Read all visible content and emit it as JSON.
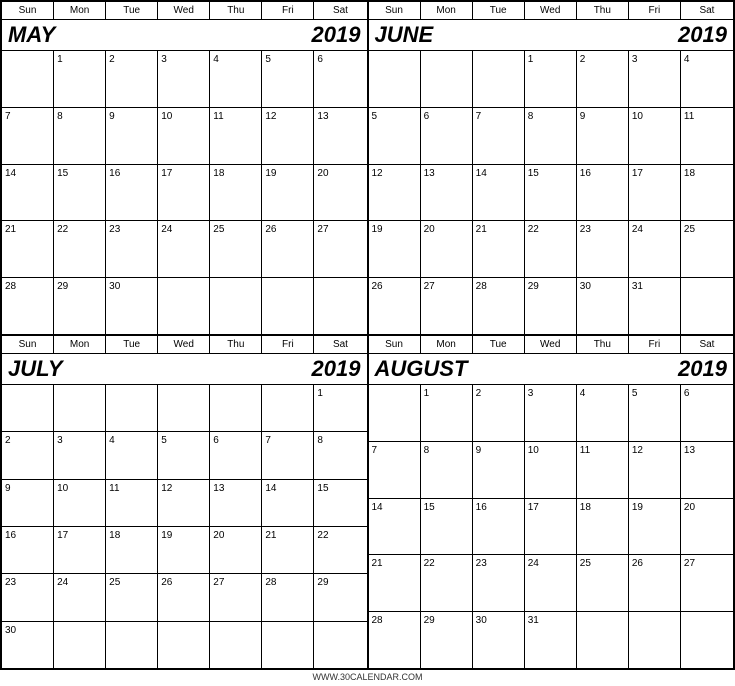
{
  "footer": "WWW.30CALENDAR.COM",
  "calendars": [
    {
      "id": "may",
      "month": "MAY",
      "year": "2019",
      "days": [
        "Sun",
        "Mon",
        "Tue",
        "Wed",
        "Thu",
        "Fri",
        "Sat"
      ],
      "weeks": [
        [
          "",
          "1",
          "2",
          "3",
          "4",
          "5",
          "6"
        ],
        [
          "7",
          "8",
          "9",
          "10",
          "11",
          "12",
          "13"
        ],
        [
          "14",
          "15",
          "16",
          "17",
          "18",
          "19",
          "20"
        ],
        [
          "21",
          "22",
          "23",
          "24",
          "25",
          "26",
          "27"
        ],
        [
          "28",
          "29",
          "30",
          "",
          "",
          "",
          ""
        ]
      ]
    },
    {
      "id": "june",
      "month": "JUNE",
      "year": "2019",
      "days": [
        "Sun",
        "Mon",
        "Tue",
        "Wed",
        "Thu",
        "Fri",
        "Sat"
      ],
      "weeks": [
        [
          "",
          "",
          "",
          "",
          "",
          "1",
          "2",
          "3",
          "4"
        ],
        [
          "5",
          "6",
          "7",
          "8",
          "9",
          "10",
          "11"
        ],
        [
          "12",
          "13",
          "14",
          "15",
          "16",
          "17",
          "18"
        ],
        [
          "19",
          "20",
          "21",
          "22",
          "23",
          "24",
          "25"
        ],
        [
          "26",
          "27",
          "28",
          "29",
          "30",
          "31",
          ""
        ]
      ]
    },
    {
      "id": "july",
      "month": "JULY",
      "year": "2019",
      "days": [
        "Sun",
        "Mon",
        "Tue",
        "Wed",
        "Thu",
        "Fri",
        "Sat"
      ],
      "weeks": [
        [
          "",
          "",
          "",
          "",
          "",
          "",
          "1"
        ],
        [
          "2",
          "3",
          "4",
          "5",
          "6",
          "7",
          "8"
        ],
        [
          "9",
          "10",
          "11",
          "12",
          "13",
          "14",
          "15"
        ],
        [
          "16",
          "17",
          "18",
          "19",
          "20",
          "21",
          "22"
        ],
        [
          "23",
          "24",
          "25",
          "26",
          "27",
          "28",
          "29"
        ],
        [
          "30",
          "",
          "",
          "",
          "",
          "",
          ""
        ]
      ]
    },
    {
      "id": "august",
      "month": "AUGUST",
      "year": "2019",
      "days": [
        "Sun",
        "Mon",
        "Tue",
        "Wed",
        "Thu",
        "Fri",
        "Sat"
      ],
      "weeks": [
        [
          "",
          "1",
          "2",
          "3",
          "4",
          "5",
          "6"
        ],
        [
          "7",
          "8",
          "9",
          "10",
          "11",
          "12",
          "13"
        ],
        [
          "14",
          "15",
          "16",
          "17",
          "18",
          "19",
          "20"
        ],
        [
          "21",
          "22",
          "23",
          "24",
          "25",
          "26",
          "27"
        ],
        [
          "28",
          "29",
          "30",
          "31",
          "",
          "",
          ""
        ]
      ]
    }
  ]
}
